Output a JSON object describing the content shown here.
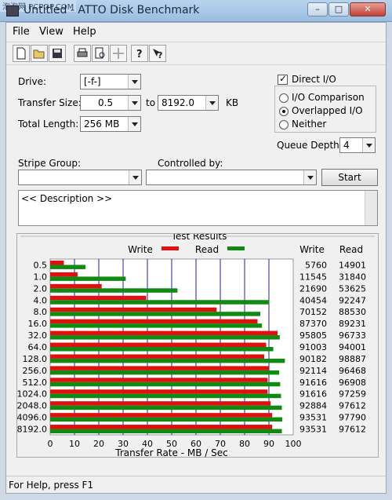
{
  "watermark": "泡泡网 PCPOP.COM",
  "window": {
    "title": "Untitled - ATTO Disk Benchmark"
  },
  "menu": {
    "file": "File",
    "view": "View",
    "help": "Help"
  },
  "toolbar_icons": [
    "new-file-icon",
    "open-folder-icon",
    "save-icon",
    "print-icon",
    "print-preview-icon",
    "move-icon",
    "help-icon",
    "context-help-icon"
  ],
  "form": {
    "drive_label": "Drive:",
    "drive_value": "[-f-]",
    "transfer_size_label": "Transfer Size:",
    "transfer_from": "0.5",
    "to_label": "to",
    "transfer_to": "8192.0",
    "kb_unit": "KB",
    "total_length_label": "Total Length:",
    "total_length_value": "256 MB",
    "direct_io_label": "Direct I/O",
    "io_comparison_label": "I/O Comparison",
    "overlapped_io_label": "Overlapped I/O",
    "neither_label": "Neither",
    "queue_depth_label": "Queue Depth:",
    "queue_depth_value": "4",
    "stripe_group_label": "Stripe Group:",
    "controlled_by_label": "Controlled by:",
    "start_label": "Start",
    "description": "<< Description >>"
  },
  "results": {
    "title": "Test Results",
    "write_legend": "Write",
    "read_legend": "Read",
    "write_col": "Write",
    "read_col": "Read"
  },
  "chart_data": {
    "type": "bar",
    "orientation": "horizontal",
    "categories": [
      "0.5",
      "1.0",
      "2.0",
      "4.0",
      "8.0",
      "16.0",
      "32.0",
      "64.0",
      "128.0",
      "256.0",
      "512.0",
      "1024.0",
      "2048.0",
      "4096.0",
      "8192.0"
    ],
    "series": [
      {
        "name": "Write",
        "color": "#e01010",
        "values_kb": [
          5760,
          11545,
          21690,
          40454,
          70152,
          87370,
          95805,
          91003,
          90182,
          92114,
          91616,
          91616,
          92884,
          93531,
          93531
        ]
      },
      {
        "name": "Read",
        "color": "#108a10",
        "values_kb": [
          14901,
          31840,
          53625,
          92247,
          88530,
          89231,
          96733,
          94001,
          98887,
          96468,
          96908,
          97259,
          97612,
          97790,
          97612
        ]
      }
    ],
    "xlabel": "Transfer Rate - MB / Sec",
    "xticks": [
      "0",
      "10",
      "20",
      "30",
      "40",
      "50",
      "60",
      "70",
      "80",
      "90",
      "100"
    ],
    "xlim": [
      0,
      100
    ],
    "grid": true
  },
  "status": {
    "text": "For Help, press F1"
  },
  "colors": {
    "write": "#e01010",
    "read": "#108a10",
    "grid": "#2020a0"
  }
}
